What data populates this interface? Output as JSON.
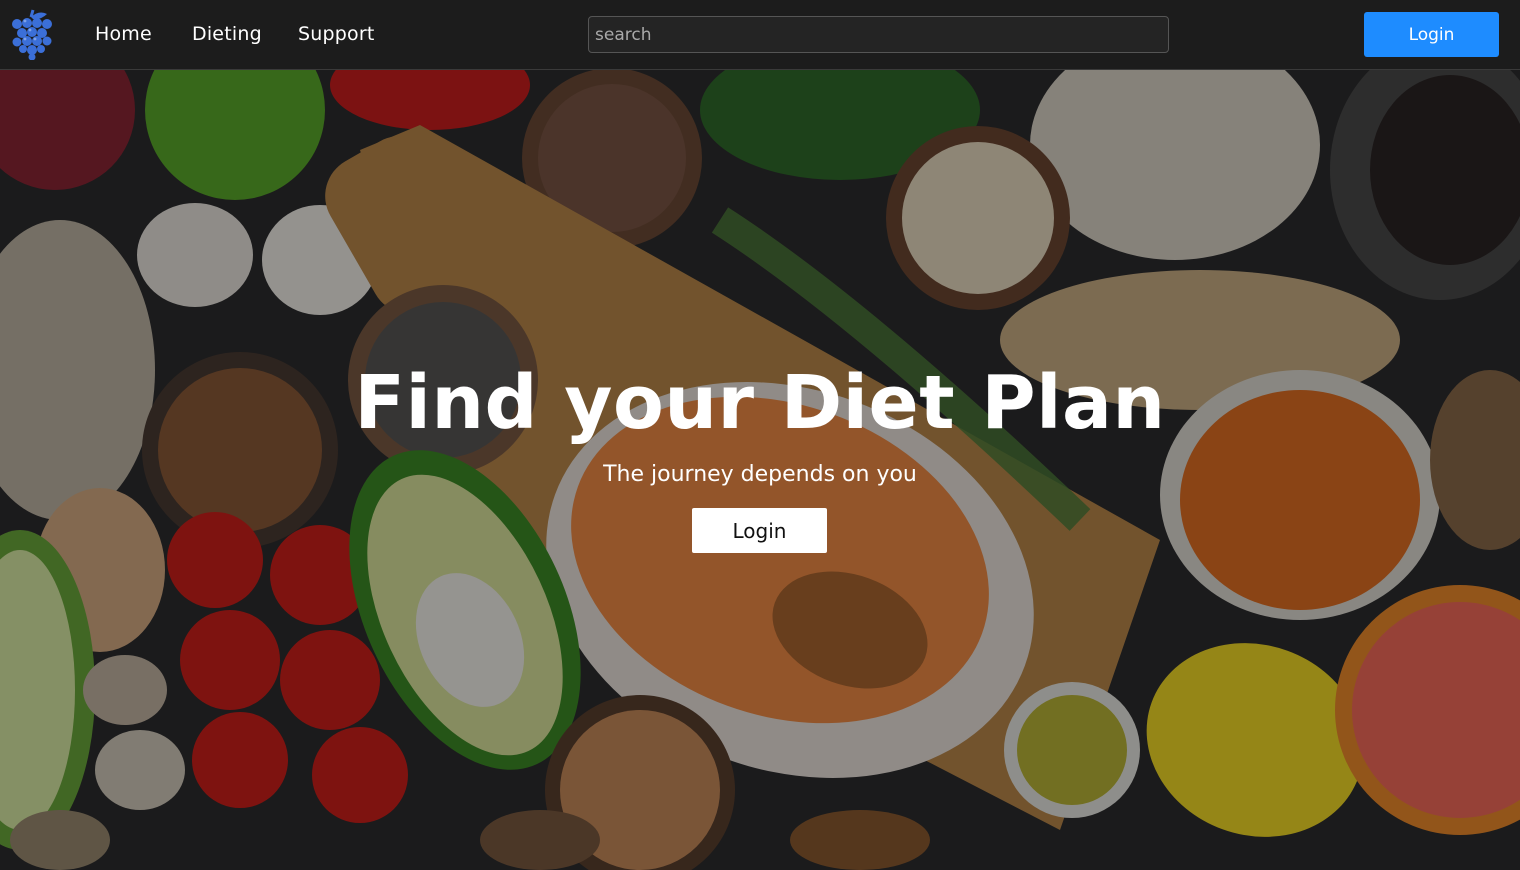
{
  "navbar": {
    "logo_icon": "grapes-icon",
    "links": [
      {
        "label": "Home"
      },
      {
        "label": "Dieting"
      },
      {
        "label": "Support"
      }
    ],
    "search": {
      "placeholder": "search",
      "value": ""
    },
    "login_label": "Login",
    "colors": {
      "background": "#1c1c1c",
      "login_button": "#1e8cff",
      "logo": "#3b6fd8"
    }
  },
  "hero": {
    "background_image": "healthy-food-flatlay-photo",
    "title": "Find your Diet Plan",
    "subtitle": "The journey depends on you",
    "login_label": "Login"
  }
}
